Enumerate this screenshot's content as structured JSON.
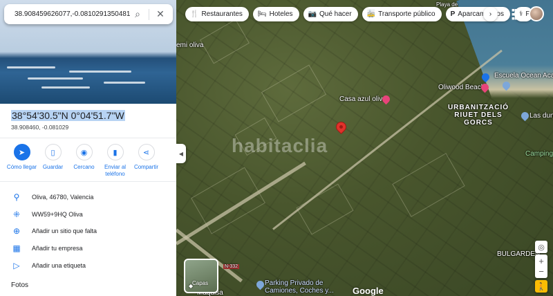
{
  "search": {
    "value": "38.908459626077,-0.0810291350481(",
    "search_icon": "search-icon",
    "close_icon": "close-icon"
  },
  "place": {
    "title": "38°54'30.5\"N 0°04'51.7\"W",
    "decimal": "38.908460, -0.081029"
  },
  "actions": [
    {
      "label": "Cómo llegar",
      "icon": "directions-icon"
    },
    {
      "label": "Guardar",
      "icon": "bookmark-icon"
    },
    {
      "label": "Cercano",
      "icon": "nearby-icon"
    },
    {
      "label": "Enviar al teléfono",
      "icon": "send-to-phone-icon"
    },
    {
      "label": "Compartir",
      "icon": "share-icon"
    }
  ],
  "info": [
    {
      "text": "Oliva, 46780, Valencia",
      "icon": "location-pin-icon"
    },
    {
      "text": "WW59+9HQ Oliva",
      "icon": "plus-code-icon"
    },
    {
      "text": "Añadir un sitio que falta",
      "icon": "add-place-icon"
    },
    {
      "text": "Añadir tu empresa",
      "icon": "business-icon"
    },
    {
      "text": "Añadir una etiqueta",
      "icon": "label-icon"
    }
  ],
  "photos_heading": "Fotos",
  "chips": [
    {
      "label": "Restaurantes",
      "icon": "restaurant-icon"
    },
    {
      "label": "Hoteles",
      "icon": "hotel-icon"
    },
    {
      "label": "Qué hacer",
      "icon": "camera-icon"
    },
    {
      "label": "Transporte público",
      "icon": "transit-icon"
    },
    {
      "label": "Aparcamientos",
      "icon": "parking-icon"
    },
    {
      "label": "F",
      "icon": "pharmacy-icon"
    }
  ],
  "map_labels": {
    "emi": "emi oliva",
    "casa": "Casa azul oliva",
    "escuela": "Escuela Ocean Acade",
    "oliwood": "Oliwood Beach",
    "urban": "URBANITZACIÓ RIUET DELS GORCS",
    "dunas": "Las duna",
    "camping": "Camping A",
    "bulgarden": "BULGARDEN",
    "parking": "Parking Privado de Camiones, Coches y...",
    "maquisa": "Maquisa",
    "road": "N-332",
    "playa": "Playa de"
  },
  "watermark": "habitaclia",
  "layers_label": "Capas",
  "google": "Google",
  "colors": {
    "accent": "#1a73e8",
    "pin": "#e0322b"
  }
}
